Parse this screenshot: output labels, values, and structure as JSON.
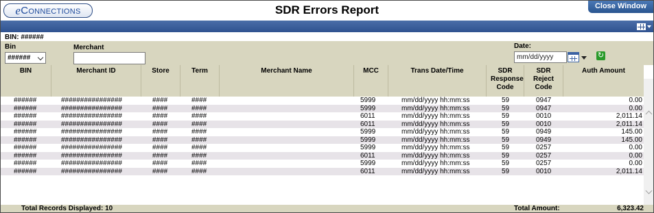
{
  "app": {
    "logo_e": "e",
    "logo_rest": "Connections",
    "title": "SDR Errors Report",
    "close_label": "Close Window"
  },
  "bin_header": "BIN: ######",
  "filters": {
    "bin_label": "Bin",
    "bin_value": "######",
    "merchant_label": "Merchant",
    "merchant_value": "",
    "date_label": "Date:",
    "date_value": "mm/dd/yyyy"
  },
  "columns": [
    "BIN",
    "Merchant ID",
    "Store",
    "Term",
    "Merchant Name",
    "MCC",
    "Trans Date/Time",
    "SDR Response Code",
    "SDR Reject Code",
    "Auth Amount"
  ],
  "rows": [
    [
      "######",
      "################",
      "####",
      "####",
      "",
      "5999",
      "mm/dd/yyyy hh:mm:ss",
      "59",
      "0947",
      "0.00"
    ],
    [
      "######",
      "################",
      "####",
      "####",
      "",
      "5999",
      "mm/dd/yyyy hh:mm:ss",
      "59",
      "0947",
      "0.00"
    ],
    [
      "######",
      "################",
      "####",
      "####",
      "",
      "6011",
      "mm/dd/yyyy hh:mm:ss",
      "59",
      "0010",
      "2,011.14"
    ],
    [
      "######",
      "################",
      "####",
      "####",
      "",
      "6011",
      "mm/dd/yyyy hh:mm:ss",
      "59",
      "0010",
      "2,011.14"
    ],
    [
      "######",
      "################",
      "####",
      "####",
      "",
      "5999",
      "mm/dd/yyyy hh:mm:ss",
      "59",
      "0949",
      "145.00"
    ],
    [
      "######",
      "################",
      "####",
      "####",
      "",
      "5999",
      "mm/dd/yyyy hh:mm:ss",
      "59",
      "0949",
      "145.00"
    ],
    [
      "######",
      "################",
      "####",
      "####",
      "",
      "5999",
      "mm/dd/yyyy hh:mm:ss",
      "59",
      "0257",
      "0.00"
    ],
    [
      "######",
      "################",
      "####",
      "####",
      "",
      "6011",
      "mm/dd/yyyy hh:mm:ss",
      "59",
      "0257",
      "0.00"
    ],
    [
      "######",
      "################",
      "####",
      "####",
      "",
      "5999",
      "mm/dd/yyyy hh:mm:ss",
      "59",
      "0257",
      "0.00"
    ],
    [
      "######",
      "################",
      "####",
      "####",
      "",
      "6011",
      "mm/dd/yyyy hh:mm:ss",
      "59",
      "0010",
      "2,011.14"
    ]
  ],
  "footer": {
    "total_records": "Total Records Displayed: 10",
    "total_amount_label": "Total Amount:",
    "total_amount_value": "6,323.42"
  },
  "icons": {
    "grid_menu": "grid-menu-icon",
    "calendar": "calendar-icon",
    "refresh": "refresh-icon"
  },
  "colors": {
    "header_bar": "#2f5290",
    "filter_bg": "#d8d6bf",
    "alt_row": "#e7e3e8"
  }
}
